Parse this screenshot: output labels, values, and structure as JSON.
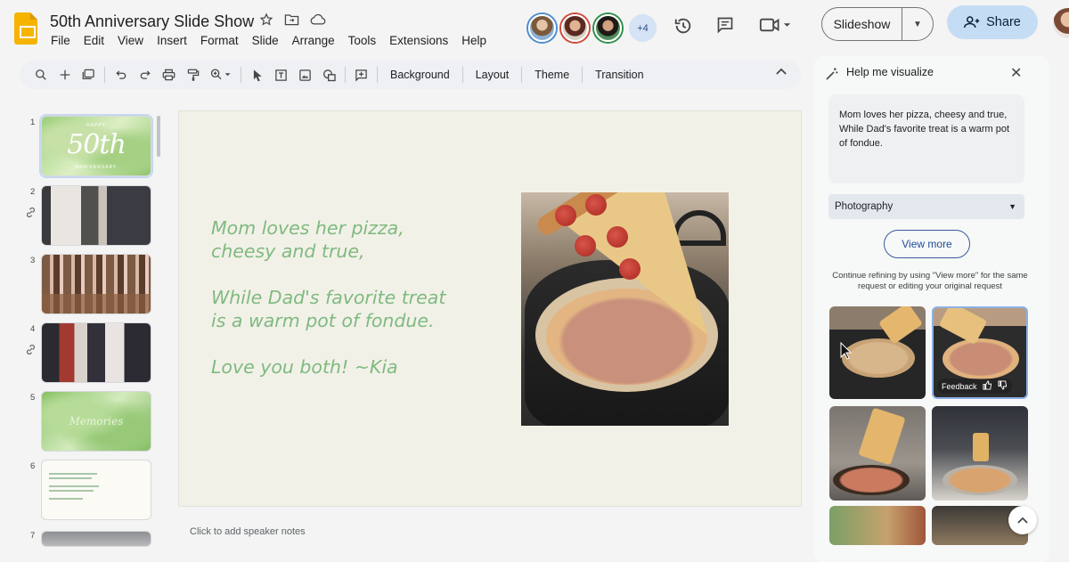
{
  "document": {
    "title": "50th Anniversary Slide Show"
  },
  "menu": [
    "File",
    "Edit",
    "View",
    "Insert",
    "Format",
    "Slide",
    "Arrange",
    "Tools",
    "Extensions",
    "Help"
  ],
  "header": {
    "collaborators_more": "+4",
    "slideshow_label": "Slideshow",
    "share_label": "Share"
  },
  "toolbar": {
    "background_label": "Background",
    "layout_label": "Layout",
    "theme_label": "Theme",
    "transition_label": "Transition"
  },
  "filmstrip": {
    "slides": [
      {
        "number": "1",
        "thumb_text": "50th",
        "thumb_top": "HAPPY",
        "thumb_bottom": "ANNIVERSARY"
      },
      {
        "number": "2"
      },
      {
        "number": "3"
      },
      {
        "number": "4"
      },
      {
        "number": "5",
        "thumb_text": "Memories"
      },
      {
        "number": "6"
      },
      {
        "number": "7"
      }
    ]
  },
  "slide": {
    "stanza1_line1": "Mom loves her pizza,",
    "stanza1_line2": "cheesy and true,",
    "stanza2_line1": "While Dad's favorite treat",
    "stanza2_line2": "is a warm pot of fondue.",
    "stanza3_line1": "Love you both! ~Kia"
  },
  "speaker_notes": {
    "placeholder": "Click to add speaker notes"
  },
  "side_panel": {
    "title": "Help me visualize",
    "prompt": "Mom loves her pizza, cheesy and true, While Dad's favorite treat is a warm pot of fondue.",
    "style_selected": "Photography",
    "view_more_label": "View more",
    "refine_note": "Continue refining by using \"View more\" for the same request or editing your original request",
    "feedback_label": "Feedback"
  },
  "colors": {
    "accent_blue": "#1d4d9a",
    "share_bg": "#c5dcf5",
    "poem_green": "#7fba80",
    "slides_yellow": "#f6b400"
  }
}
